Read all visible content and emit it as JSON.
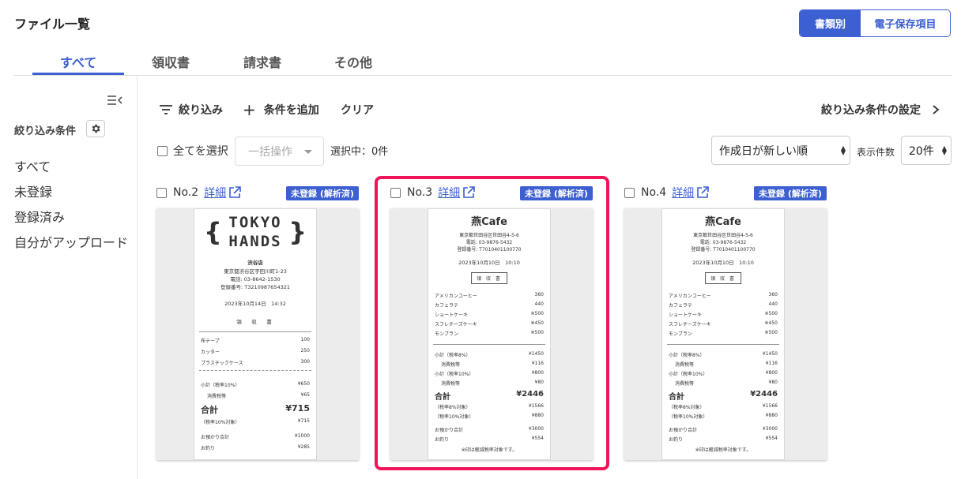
{
  "page_title": "ファイル一覧",
  "view_toggle": {
    "by_type": "書類別",
    "by_item": "電子保存項目"
  },
  "tabs": [
    "すべて",
    "領収書",
    "請求書",
    "その他"
  ],
  "sidebar": {
    "filter_heading": "絞り込み条件",
    "items": [
      "すべて",
      "未登録",
      "登録済み",
      "自分がアップロード"
    ]
  },
  "toolbar": {
    "filter": "絞り込み",
    "add_condition": "条件を追加",
    "clear": "クリア",
    "filter_settings": "絞り込み条件の設定"
  },
  "list_controls": {
    "select_all": "全てを選択",
    "bulk_action": "一括操作",
    "selected": "選択中：0件",
    "sort": "作成日が新しい順",
    "per_page_label": "表示件数",
    "per_page": "20件"
  },
  "cards": [
    {
      "number": "No.2",
      "detail": "詳細",
      "status": "未登録 (解析済)",
      "receipt": {
        "logo_top": "TOKYO",
        "logo_bottom": "HANDS",
        "store": "渋谷店",
        "address": "東京都渋谷区宇田川町1-23",
        "phone": "電話: 03-8642-1530",
        "reg": "登録番号: T3210987654321",
        "datetime": "2023年10月14日　14:32",
        "doc_title": "領　収　書",
        "items": [
          [
            "布テープ",
            "100"
          ],
          [
            "カッター",
            "250"
          ],
          [
            "プラスチックケース",
            "300"
          ]
        ],
        "subtotal": [
          "小計（税率10%）",
          "¥650"
        ],
        "tax": [
          "消費税等",
          "¥65"
        ],
        "total": [
          "合計",
          "¥715"
        ],
        "taxable": [
          "（税率10%対象）",
          "¥715"
        ],
        "paid": [
          "お預かり合計",
          "¥1000"
        ],
        "change": [
          "お釣り",
          "¥285"
        ]
      }
    },
    {
      "number": "No.3",
      "detail": "詳細",
      "status": "未登録 (解析済)",
      "receipt": {
        "name": "燕Cafe",
        "address": "東京都世田谷区世田谷4-5-6",
        "phone": "電話: 03-9876-5432",
        "reg": "登録番号: T7010401100770",
        "datetime": "2023年10月10日　10:10",
        "doc_title": "領 収 書",
        "items": [
          [
            "アメリカンコーヒー",
            "360"
          ],
          [
            "カフェラテ",
            "440"
          ],
          [
            "ショートケーキ",
            "※500"
          ],
          [
            "スフレチーズケーキ",
            "※450"
          ],
          [
            "モンブラン",
            "※500"
          ]
        ],
        "sub8": [
          "小計（税率8%）",
          "¥1450"
        ],
        "tax8": [
          "消費税等",
          "¥116"
        ],
        "sub10": [
          "小計（税率10%）",
          "¥800"
        ],
        "tax10": [
          "消費税等",
          "¥80"
        ],
        "total": [
          "合計",
          "¥2446"
        ],
        "taxable8": [
          "（税率8%対象）",
          "¥1566"
        ],
        "taxable10": [
          "（税率10%対象）",
          "¥880"
        ],
        "paid": [
          "お預かり合計",
          "¥3000"
        ],
        "change": [
          "お釣り",
          "¥554"
        ],
        "note": "※印は軽減税率対象です。"
      }
    },
    {
      "number": "No.4",
      "detail": "詳細",
      "status": "未登録 (解析済)",
      "receipt": {
        "name": "燕Cafe",
        "address": "東京都世田谷区世田谷4-5-6",
        "phone": "電話: 03-9876-5432",
        "reg": "登録番号: T7010401100770",
        "datetime": "2023年10月10日　10:10",
        "doc_title": "領 収 書",
        "items": [
          [
            "アメリカンコーヒー",
            "360"
          ],
          [
            "カフェラテ",
            "440"
          ],
          [
            "ショートケーキ",
            "※500"
          ],
          [
            "スフレチーズケーキ",
            "※450"
          ],
          [
            "モンブラン",
            "※500"
          ]
        ],
        "sub8": [
          "小計（税率8%）",
          "¥1450"
        ],
        "tax8": [
          "消費税等",
          "¥116"
        ],
        "sub10": [
          "小計（税率10%）",
          "¥800"
        ],
        "tax10": [
          "消費税等",
          "¥80"
        ],
        "total": [
          "合計",
          "¥2446"
        ],
        "taxable8": [
          "（税率8%対象）",
          "¥1566"
        ],
        "taxable10": [
          "（税率10%対象）",
          "¥880"
        ],
        "paid": [
          "お預かり合計",
          "¥3000"
        ],
        "change": [
          "お釣り",
          "¥554"
        ],
        "note": "※印は軽減税率対象です。"
      }
    }
  ],
  "colors": {
    "accent": "#3c5fd1",
    "highlight": "#f0145a"
  }
}
